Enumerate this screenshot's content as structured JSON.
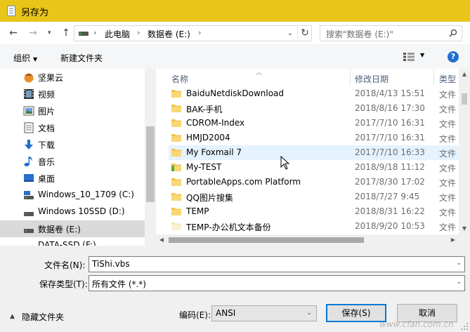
{
  "window": {
    "title": "另存为"
  },
  "nav": {
    "breadcrumb": [
      "此电脑",
      "数据卷 (E:)"
    ],
    "search_placeholder": "搜索\"数据卷 (E:)\""
  },
  "toolbar": {
    "organize": "组织",
    "new_folder": "新建文件夹"
  },
  "sidebar": {
    "items": [
      {
        "label": "坚果云",
        "icon": "nutstore-icon"
      },
      {
        "label": "视频",
        "icon": "video-icon"
      },
      {
        "label": "图片",
        "icon": "pictures-icon"
      },
      {
        "label": "文档",
        "icon": "documents-icon"
      },
      {
        "label": "下载",
        "icon": "downloads-icon"
      },
      {
        "label": "音乐",
        "icon": "music-icon"
      },
      {
        "label": "桌面",
        "icon": "desktop-icon"
      },
      {
        "label": "Windows_10_1709 (C:)",
        "icon": "drive-icon"
      },
      {
        "label": "Windows 10SSD (D:)",
        "icon": "drive-icon"
      },
      {
        "label": "数据卷 (E:)",
        "icon": "drive-icon",
        "selected": true
      },
      {
        "label": "DATA-SSD (F:)",
        "icon": "drive-icon"
      }
    ]
  },
  "filelist": {
    "columns": {
      "name": "名称",
      "modified": "修改日期",
      "type": "类型"
    },
    "rows": [
      {
        "name": "BaiduNetdiskDownload",
        "modified": "2018/4/13 15:51",
        "type": "文件"
      },
      {
        "name": "BAK-手机",
        "modified": "2018/8/16 17:30",
        "type": "文件"
      },
      {
        "name": "CDROM-Index",
        "modified": "2017/7/10 16:31",
        "type": "文件"
      },
      {
        "name": "HMJD2004",
        "modified": "2017/7/10 16:31",
        "type": "文件"
      },
      {
        "name": "My Foxmail 7",
        "modified": "2017/7/10 16:33",
        "type": "文件",
        "hover": true
      },
      {
        "name": "My-TEST",
        "modified": "2018/9/18 11:12",
        "type": "文件"
      },
      {
        "name": "PortableApps.com Platform",
        "modified": "2017/8/30 17:02",
        "type": "文件"
      },
      {
        "name": "QQ图片搜集",
        "modified": "2018/7/27 9:45",
        "type": "文件"
      },
      {
        "name": "TEMP",
        "modified": "2018/8/31 16:22",
        "type": "文件"
      },
      {
        "name": "TEMP-办公机文本备份",
        "modified": "2018/9/20 10:53",
        "type": "文件"
      }
    ]
  },
  "form": {
    "filename_label": "文件名(N):",
    "filename_value": "TiShi.vbs",
    "filetype_label": "保存类型(T):",
    "filetype_value": "所有文件  (*.*)",
    "encoding_label": "编码(E):",
    "encoding_value": "ANSI",
    "save_button": "保存(S)",
    "cancel_button": "取消",
    "hide_folders": "隐藏文件夹"
  },
  "watermark": "www.cfan.com.cn",
  "colors": {
    "titlebar": "#e9c51a",
    "selection": "#cce4f7",
    "hover": "#e5f3ff",
    "folder": "#f1c351",
    "accent": "#0078d7"
  }
}
